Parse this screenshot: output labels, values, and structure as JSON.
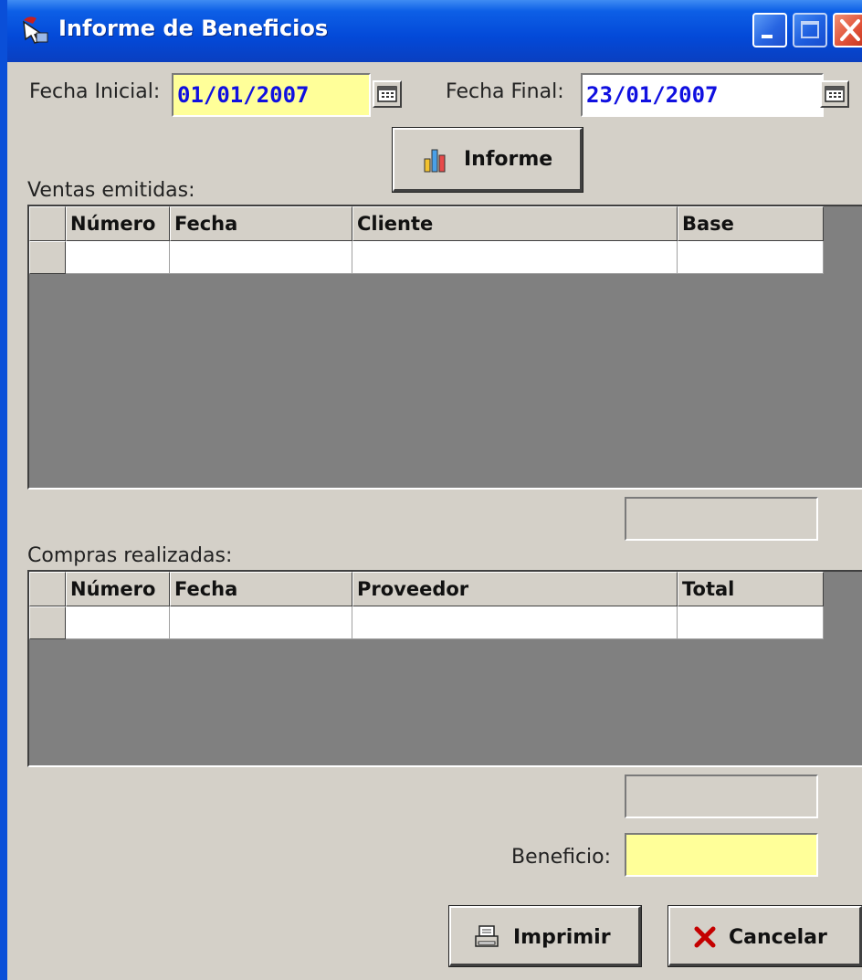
{
  "window": {
    "title": "Informe de Beneficios"
  },
  "filters": {
    "fecha_inicial_label": "Fecha Inicial:",
    "fecha_inicial_value": "01/01/2007",
    "fecha_final_label": "Fecha Final:",
    "fecha_final_value": "23/01/2007"
  },
  "informe_button": {
    "label": "Informe"
  },
  "ventas": {
    "label": "Ventas emitidas:",
    "columns": [
      "Número",
      "Fecha",
      "Cliente",
      "Base"
    ],
    "total": ""
  },
  "compras": {
    "label": "Compras realizadas:",
    "columns": [
      "Número",
      "Fecha",
      "Proveedor",
      "Total"
    ],
    "total": ""
  },
  "beneficio": {
    "label": "Beneficio:",
    "value": ""
  },
  "actions": {
    "imprimir": "Imprimir",
    "cancelar": "Cancelar"
  },
  "colors": {
    "date_field_bg": "#ffff99",
    "title_bar": "#0349d8",
    "grid_bg": "#808080"
  }
}
